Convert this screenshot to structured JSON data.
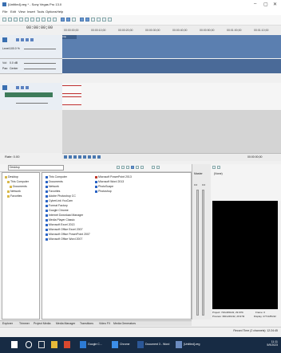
{
  "window": {
    "title": "[Untitled].veg * - Sony Vegas Pro 13.0",
    "minimize": "–",
    "maximize": "▢",
    "close": "✕"
  },
  "menus": [
    "File",
    "Edit",
    "View",
    "Insert",
    "Tools",
    "Options",
    "Help"
  ],
  "timeline": {
    "cursor_time": "00:00:00;00",
    "ruler_ticks": [
      "00:00:00;00",
      "00:00:10;00",
      "00:00:20;00",
      "00:00:30;00",
      "00:00:40;00",
      "00:00:50;00",
      "00:01:00;00",
      "00:01:10;00"
    ],
    "clip_label": "Clip",
    "track1": {
      "level_label": "Level:",
      "level_value": "100.0 %"
    },
    "track2": {
      "vol_label": "Vol:",
      "vol_value": "0.0 dB",
      "pan_label": "Pan:",
      "pan_value": "Center"
    },
    "rate_label": "Rate: 0.00",
    "end_time": "00:00:00;00",
    "start_field": "00:00:00;00"
  },
  "explorer": {
    "path": "Desktop",
    "tree": [
      "Desktop",
      "This Computer",
      "Documents",
      "Network",
      "Favorites"
    ],
    "files_col1": [
      "This Computer",
      "Documents",
      "Network",
      "Favorites",
      "Adobe Photoshop CC",
      "CyberLink YouCam",
      "Format Factory",
      "Google Chrome",
      "Internet Download Manager",
      "Media Player Classic",
      "Microsoft Excel 2013",
      "Microsoft Office Excel 2007",
      "Microsoft Office PowerPoint 2007",
      "Microsoft Office Word 2007"
    ],
    "files_col2": [
      "Microsoft PowerPoint 2013",
      "Microsoft Word 2013",
      "PhotoScape",
      "Photoshop"
    ]
  },
  "bottom_tabs": [
    "Explorer",
    "Trimmer",
    "Project Media",
    "Media Manager",
    "Transitions",
    "Video FX",
    "Media Generators"
  ],
  "master": {
    "label": "Master",
    "values": [
      "0.0",
      "0.0"
    ]
  },
  "preview": {
    "title": "(None)",
    "project_label": "Project: 720x480x32, 29.970i",
    "preview_label": "Preview: 360x240x32, 29.970i",
    "frame_label": "Frame: 0",
    "display_label": "Display: 277x185x32",
    "record_time": "Record Time (2 channels): 12:24:45"
  },
  "taskbar": {
    "items": [
      "Start",
      "Search",
      "Task View",
      "Explorer",
      "Sony Vegas",
      "Google C...",
      "Chrome",
      "Document 3 - Word",
      "[Untitled].veg"
    ],
    "clock_time": "11:11",
    "clock_date": "5/9/2023"
  }
}
